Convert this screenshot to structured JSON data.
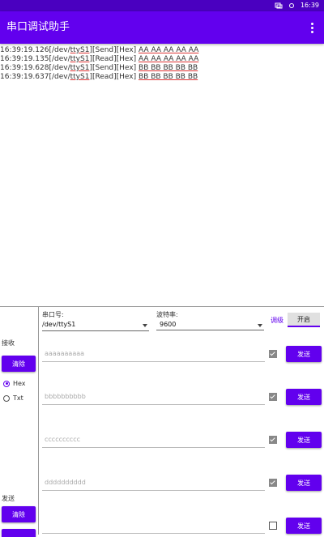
{
  "status_bar": {
    "time": "16:39",
    "icons": [
      "screen-rotate-icon",
      "settings-icon"
    ]
  },
  "app": {
    "title": "串口调试助手",
    "menu_icon": "more-vertical-icon",
    "accent": "#6200ee",
    "status_color": "#4a00c0"
  },
  "log": [
    {
      "time": "16:39:19.126",
      "dev": "/dev/",
      "port": "ttyS1",
      "dir": "[Send]",
      "fmt": "[Hex]",
      "data": "AA AA AA AA AA"
    },
    {
      "time": "16:39:19.135",
      "dev": "/dev/",
      "port": "ttyS1",
      "dir": "[Read]",
      "fmt": "[Hex]",
      "data": "AA AA AA AA AA"
    },
    {
      "time": "16:39:19.628",
      "dev": "/dev/",
      "port": "ttyS1",
      "dir": "[Send]",
      "fmt": "[Hex]",
      "data": "BB BB BB BB BB"
    },
    {
      "time": "16:39:19.637",
      "dev": "/dev/",
      "port": "ttyS1",
      "dir": "[Read]",
      "fmt": "[Hex]",
      "data": "BB BB BB BB BB"
    }
  ],
  "panel": {
    "receive_label": "接收",
    "clear_receive": "清除",
    "send_label": "发送",
    "clear_send": "清除",
    "radio_hex": "Hex",
    "radio_txt": "Txt",
    "radio_selected": "Hex",
    "port_label": "串口号:",
    "port_value": "/dev/ttyS1",
    "baud_label": "波特率:",
    "baud_value": "9600",
    "advanced": "调级",
    "open": "开启"
  },
  "send_rows": [
    {
      "placeholder": "aaaaaaaaaa",
      "checked": true,
      "button": "发送"
    },
    {
      "placeholder": "bbbbbbbbbb",
      "checked": true,
      "button": "发送"
    },
    {
      "placeholder": "cccccccccc",
      "checked": true,
      "button": "发送"
    },
    {
      "placeholder": "dddddddddd",
      "checked": true,
      "button": "发送"
    },
    {
      "placeholder": "",
      "checked": false,
      "button": "发送"
    }
  ]
}
